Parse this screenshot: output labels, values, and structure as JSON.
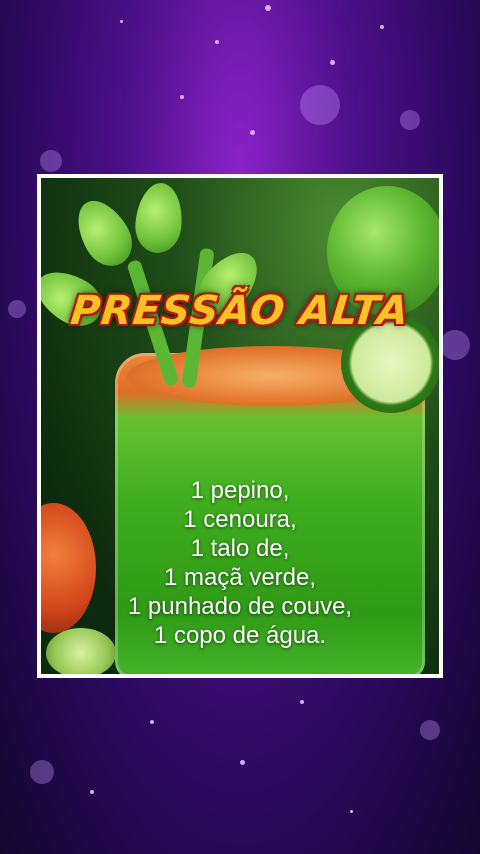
{
  "title": "PRESSÃO ALTA",
  "ingredients": [
    "1 pepino,",
    "1 cenoura,",
    "1 talo de,",
    "1 maçã verde,",
    "1 punhado de couve,",
    "1 copo de água."
  ],
  "colors": {
    "background": "#4a0f86",
    "title_fill": "#f7c224",
    "title_outline": "#b3160c",
    "juice": "#3fae1f"
  }
}
